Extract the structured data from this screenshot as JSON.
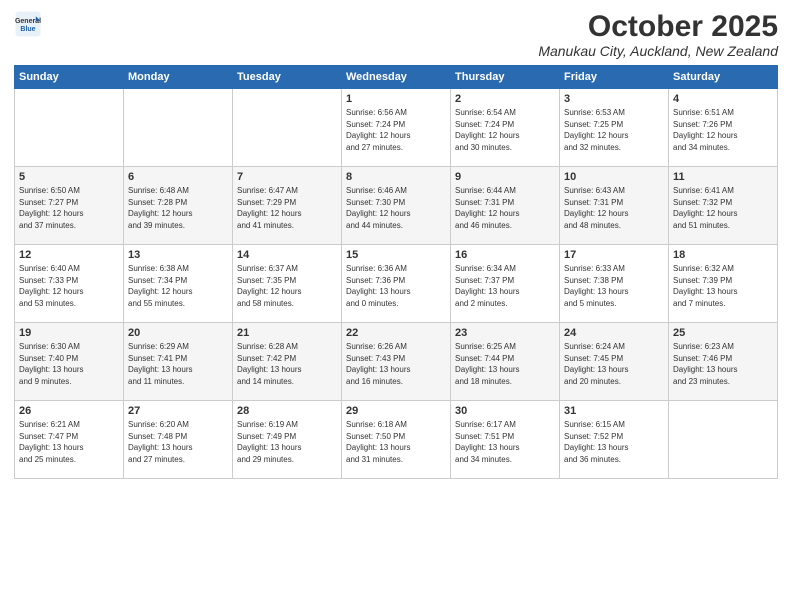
{
  "header": {
    "logo_line1": "General",
    "logo_line2": "Blue",
    "month": "October 2025",
    "location": "Manukau City, Auckland, New Zealand"
  },
  "weekdays": [
    "Sunday",
    "Monday",
    "Tuesday",
    "Wednesday",
    "Thursday",
    "Friday",
    "Saturday"
  ],
  "weeks": [
    [
      {
        "day": "",
        "info": ""
      },
      {
        "day": "",
        "info": ""
      },
      {
        "day": "",
        "info": ""
      },
      {
        "day": "1",
        "info": "Sunrise: 6:56 AM\nSunset: 7:24 PM\nDaylight: 12 hours\nand 27 minutes."
      },
      {
        "day": "2",
        "info": "Sunrise: 6:54 AM\nSunset: 7:24 PM\nDaylight: 12 hours\nand 30 minutes."
      },
      {
        "day": "3",
        "info": "Sunrise: 6:53 AM\nSunset: 7:25 PM\nDaylight: 12 hours\nand 32 minutes."
      },
      {
        "day": "4",
        "info": "Sunrise: 6:51 AM\nSunset: 7:26 PM\nDaylight: 12 hours\nand 34 minutes."
      }
    ],
    [
      {
        "day": "5",
        "info": "Sunrise: 6:50 AM\nSunset: 7:27 PM\nDaylight: 12 hours\nand 37 minutes."
      },
      {
        "day": "6",
        "info": "Sunrise: 6:48 AM\nSunset: 7:28 PM\nDaylight: 12 hours\nand 39 minutes."
      },
      {
        "day": "7",
        "info": "Sunrise: 6:47 AM\nSunset: 7:29 PM\nDaylight: 12 hours\nand 41 minutes."
      },
      {
        "day": "8",
        "info": "Sunrise: 6:46 AM\nSunset: 7:30 PM\nDaylight: 12 hours\nand 44 minutes."
      },
      {
        "day": "9",
        "info": "Sunrise: 6:44 AM\nSunset: 7:31 PM\nDaylight: 12 hours\nand 46 minutes."
      },
      {
        "day": "10",
        "info": "Sunrise: 6:43 AM\nSunset: 7:31 PM\nDaylight: 12 hours\nand 48 minutes."
      },
      {
        "day": "11",
        "info": "Sunrise: 6:41 AM\nSunset: 7:32 PM\nDaylight: 12 hours\nand 51 minutes."
      }
    ],
    [
      {
        "day": "12",
        "info": "Sunrise: 6:40 AM\nSunset: 7:33 PM\nDaylight: 12 hours\nand 53 minutes."
      },
      {
        "day": "13",
        "info": "Sunrise: 6:38 AM\nSunset: 7:34 PM\nDaylight: 12 hours\nand 55 minutes."
      },
      {
        "day": "14",
        "info": "Sunrise: 6:37 AM\nSunset: 7:35 PM\nDaylight: 12 hours\nand 58 minutes."
      },
      {
        "day": "15",
        "info": "Sunrise: 6:36 AM\nSunset: 7:36 PM\nDaylight: 13 hours\nand 0 minutes."
      },
      {
        "day": "16",
        "info": "Sunrise: 6:34 AM\nSunset: 7:37 PM\nDaylight: 13 hours\nand 2 minutes."
      },
      {
        "day": "17",
        "info": "Sunrise: 6:33 AM\nSunset: 7:38 PM\nDaylight: 13 hours\nand 5 minutes."
      },
      {
        "day": "18",
        "info": "Sunrise: 6:32 AM\nSunset: 7:39 PM\nDaylight: 13 hours\nand 7 minutes."
      }
    ],
    [
      {
        "day": "19",
        "info": "Sunrise: 6:30 AM\nSunset: 7:40 PM\nDaylight: 13 hours\nand 9 minutes."
      },
      {
        "day": "20",
        "info": "Sunrise: 6:29 AM\nSunset: 7:41 PM\nDaylight: 13 hours\nand 11 minutes."
      },
      {
        "day": "21",
        "info": "Sunrise: 6:28 AM\nSunset: 7:42 PM\nDaylight: 13 hours\nand 14 minutes."
      },
      {
        "day": "22",
        "info": "Sunrise: 6:26 AM\nSunset: 7:43 PM\nDaylight: 13 hours\nand 16 minutes."
      },
      {
        "day": "23",
        "info": "Sunrise: 6:25 AM\nSunset: 7:44 PM\nDaylight: 13 hours\nand 18 minutes."
      },
      {
        "day": "24",
        "info": "Sunrise: 6:24 AM\nSunset: 7:45 PM\nDaylight: 13 hours\nand 20 minutes."
      },
      {
        "day": "25",
        "info": "Sunrise: 6:23 AM\nSunset: 7:46 PM\nDaylight: 13 hours\nand 23 minutes."
      }
    ],
    [
      {
        "day": "26",
        "info": "Sunrise: 6:21 AM\nSunset: 7:47 PM\nDaylight: 13 hours\nand 25 minutes."
      },
      {
        "day": "27",
        "info": "Sunrise: 6:20 AM\nSunset: 7:48 PM\nDaylight: 13 hours\nand 27 minutes."
      },
      {
        "day": "28",
        "info": "Sunrise: 6:19 AM\nSunset: 7:49 PM\nDaylight: 13 hours\nand 29 minutes."
      },
      {
        "day": "29",
        "info": "Sunrise: 6:18 AM\nSunset: 7:50 PM\nDaylight: 13 hours\nand 31 minutes."
      },
      {
        "day": "30",
        "info": "Sunrise: 6:17 AM\nSunset: 7:51 PM\nDaylight: 13 hours\nand 34 minutes."
      },
      {
        "day": "31",
        "info": "Sunrise: 6:15 AM\nSunset: 7:52 PM\nDaylight: 13 hours\nand 36 minutes."
      },
      {
        "day": "",
        "info": ""
      }
    ]
  ]
}
